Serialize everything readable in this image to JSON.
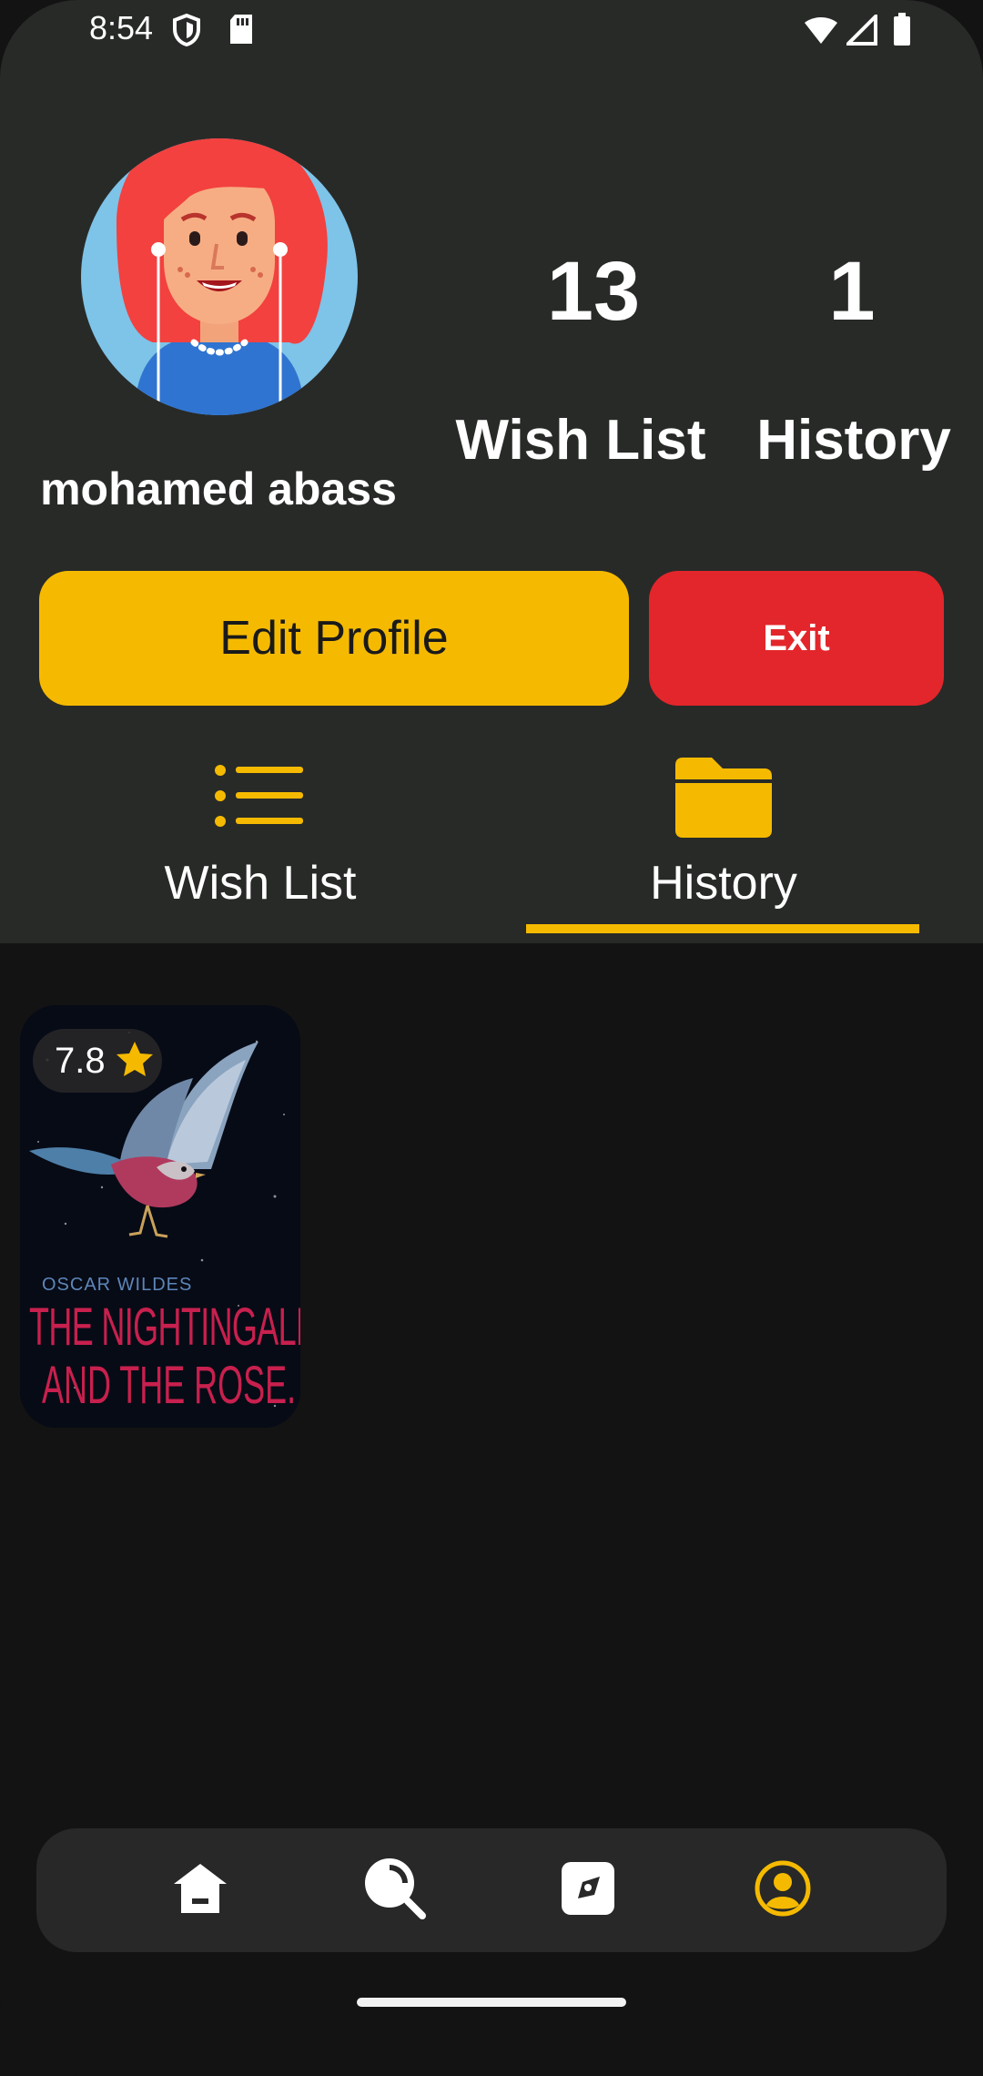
{
  "status_bar": {
    "time": "8:54",
    "icons": [
      "shield-icon",
      "sd-card-icon",
      "wifi-icon",
      "signal-icon",
      "battery-icon"
    ]
  },
  "profile": {
    "username": "mohamed abass",
    "avatar": "avatar-illustration"
  },
  "stats": [
    {
      "value": "13",
      "label": "Wish List"
    },
    {
      "value": "1",
      "label": "History"
    }
  ],
  "buttons": {
    "edit_profile": "Edit Profile",
    "exit": "Exit"
  },
  "tabs": [
    {
      "label": "Wish List",
      "icon": "list-icon",
      "active": false
    },
    {
      "label": "History",
      "icon": "folder-icon",
      "active": true
    }
  ],
  "history_items": [
    {
      "rating": "7.8",
      "cover_author": "OSCAR WILDES",
      "cover_title_line1": "THE NIGHTINGALE",
      "cover_title_line2": "AND THE ROSE."
    }
  ],
  "bottom_nav": [
    {
      "icon": "home-icon",
      "active": false
    },
    {
      "icon": "search-icon",
      "active": false
    },
    {
      "icon": "explore-icon",
      "active": false
    },
    {
      "icon": "profile-icon",
      "active": true
    }
  ],
  "colors": {
    "accent": "#f5ba00",
    "danger": "#e3262b",
    "header_bg": "#282a28",
    "body_bg": "#131313"
  }
}
